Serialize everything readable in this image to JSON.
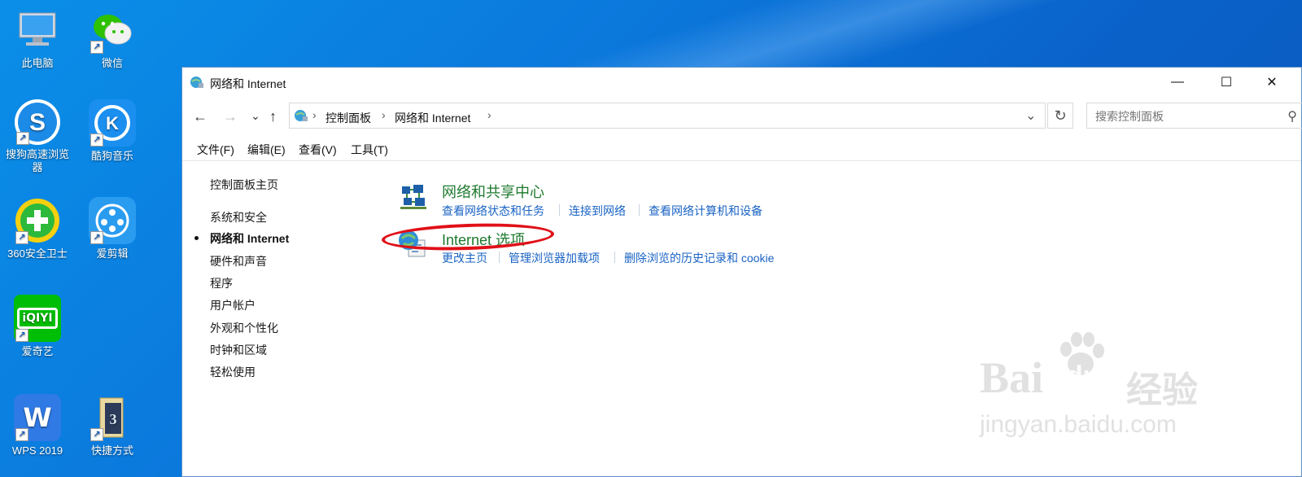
{
  "desktop": {
    "icons": [
      {
        "label": "此电脑",
        "icon": "computer-icon"
      },
      {
        "label": "微信",
        "icon": "wechat-icon"
      },
      {
        "label": "搜狗高速浏览器",
        "icon": "sogou-browser-icon"
      },
      {
        "label": "酷狗音乐",
        "icon": "kugou-icon"
      },
      {
        "label": "360安全卫士",
        "icon": "360-icon"
      },
      {
        "label": "爱剪辑",
        "icon": "aijianji-icon"
      },
      {
        "label": "爱奇艺",
        "icon": "iqiyi-icon"
      },
      {
        "label": "WPS 2019",
        "icon": "wps-icon"
      },
      {
        "label": "快捷方式",
        "icon": "shortcut-folder-icon"
      }
    ],
    "iqiyi_logo_text": "iQIYI",
    "kugou_logo_text": "K",
    "wps_logo_text": "W",
    "colors": {
      "wechat": "#2dc100",
      "sogou": "#1c8be8",
      "kugou": "#1a8ff0",
      "360": "#2db93b",
      "iqiyi": "#00be06",
      "wps": "#2f7ae5"
    }
  },
  "window": {
    "title": "网络和 Internet",
    "controls": {
      "minimize": "—",
      "maximize": "☐",
      "close": "✕"
    }
  },
  "nav": {
    "back": "←",
    "forward": "→",
    "recent": "⌄",
    "up": "↑",
    "breadcrumb": [
      "控制面板",
      "网络和 Internet"
    ],
    "separator": "›",
    "dropdown": "⌄",
    "refresh": "↻",
    "search_placeholder": "搜索控制面板",
    "search_icon": "⚲"
  },
  "menubar": [
    "文件(F)",
    "编辑(E)",
    "查看(V)",
    "工具(T)"
  ],
  "sidebar": {
    "home": "控制面板主页",
    "items": [
      "系统和安全",
      "网络和 Internet",
      "硬件和声音",
      "程序",
      "用户帐户",
      "外观和个性化",
      "时钟和区域",
      "轻松使用"
    ],
    "active_index": 1
  },
  "categories": [
    {
      "title": "网络和共享中心",
      "icon": "network-sharing-icon",
      "links": [
        "查看网络状态和任务",
        "连接到网络",
        "查看网络计算机和设备"
      ]
    },
    {
      "title": "Internet 选项",
      "icon": "internet-options-icon",
      "links": [
        "更改主页",
        "管理浏览器加载项",
        "删除浏览的历史记录和 cookie"
      ],
      "highlighted": true
    }
  ],
  "watermark": {
    "brand": "Bai",
    "brand2": "du",
    "cn": "经验",
    "url": "jingyan.baidu.com"
  },
  "colors": {
    "category_title": "#1e7a2e",
    "link": "#1a63c4",
    "highlight": "#e01018"
  }
}
